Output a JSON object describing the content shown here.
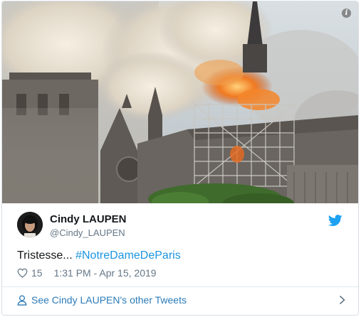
{
  "photo": {
    "alt": "Notre-Dame de Paris on fire",
    "info_icon_char": "i",
    "colors": {
      "sky": "#cfd6da",
      "smoke": "#e6e0d4",
      "fire": "#f07a22",
      "stone": "#6e6a66",
      "trees": "#3f6b2c"
    }
  },
  "author": {
    "display_name": "Cindy LAUPEN",
    "handle": "@Cindy_LAUPEN",
    "avatar_icon": "profile-photo"
  },
  "tweet": {
    "text_prefix": "Tristesse... ",
    "hashtag": "#NotreDameDeParis"
  },
  "meta": {
    "like_count": "15",
    "timestamp": "1:31 PM - Apr 15, 2019"
  },
  "footer": {
    "label": "See Cindy LAUPEN's other Tweets"
  },
  "colors": {
    "accent": "#1b95e0",
    "twitter_bird": "#1da1f2",
    "secondary_text": "#657786",
    "border": "#e1e8ed"
  }
}
